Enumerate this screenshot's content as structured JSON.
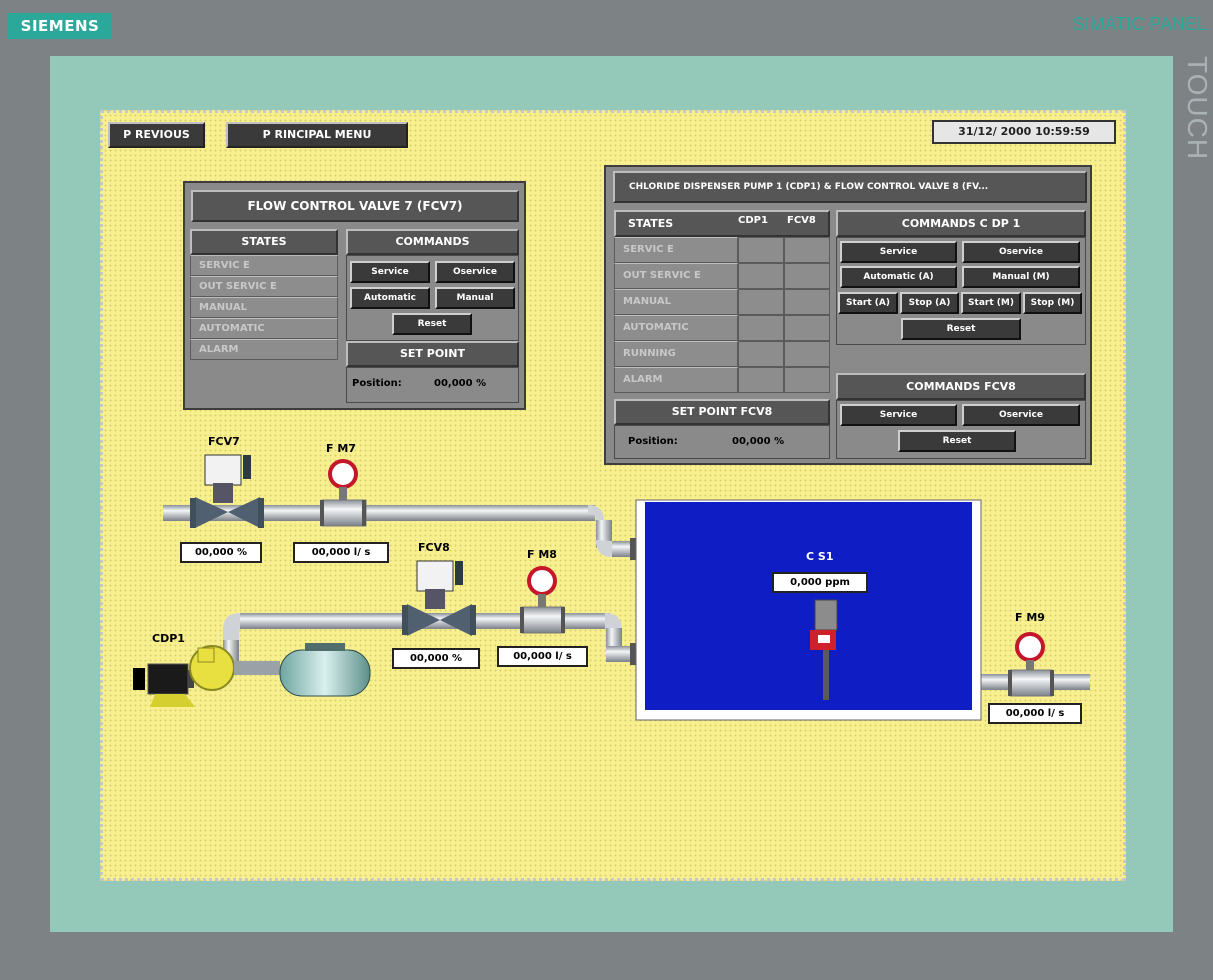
{
  "brand": "SIEMENS",
  "device": "SIMATIC PANEL",
  "touch": "TOUCH",
  "nav": {
    "previous": "P REVIOUS",
    "principal": "P RINCIPAL MENU"
  },
  "datetime": "31/12/ 2000 10:59:59",
  "fcv7_panel": {
    "title": "FLOW CONTROL VALVE 7 (FCV7)",
    "states_header": "STATES",
    "states": [
      "SERVIC E",
      "OUT SERVIC E",
      "MANUAL",
      "AUTOMATIC",
      "ALARM"
    ],
    "commands_header": "COMMANDS",
    "commands": {
      "service": "Service",
      "oservice": "Oservice",
      "automatic": "Automatic",
      "manual": "Manual",
      "reset": "Reset"
    },
    "setpoint_header": "SET POINT",
    "position_label": "Position:",
    "position_value": "00,000 %"
  },
  "cdp1_panel": {
    "title": "CHLORIDE DISPENSER PUMP 1 (CDP1) & FLOW CONTROL VALVE 8 (FV...",
    "states_header": "STATES",
    "col1": "CDP1",
    "col2": "FCV8",
    "states": [
      "SERVIC E",
      "OUT SERVIC E",
      "MANUAL",
      "AUTOMATIC",
      "RUNNING",
      "ALARM"
    ],
    "cmd_cdp1_header": "COMMANDS C DP 1",
    "cmd_cdp1": {
      "service": "Service",
      "oservice": "Oservice",
      "automatic": "Automatic (A)",
      "manual": "Manual (M)",
      "start_a": "Start (A)",
      "stop_a": "Stop (A)",
      "start_m": "Start (M)",
      "stop_m": "Stop (M)",
      "reset": "Reset"
    },
    "cmd_fcv8_header": "COMMANDS FCV8",
    "cmd_fcv8": {
      "service": "Service",
      "oservice": "Oservice",
      "reset": "Reset"
    },
    "setpoint_header": "SET POINT FCV8",
    "position_label": "Position:",
    "position_value": "00,000 %"
  },
  "process": {
    "fcv7_label": "FCV7",
    "fm7_label": "F M7",
    "fcv8_label": "FCV8",
    "fm8_label": "F M8",
    "fm9_label": "F M9",
    "cdp1_label": "CDP1",
    "cs1_label": "C S1",
    "fcv7_value": "00,000 %",
    "fm7_value": "00,000 l/ s",
    "fcv8_value": "00,000 %",
    "fm8_value": "00,000 l/ s",
    "fm9_value": "00,000 l/ s",
    "cs1_value": "0,000 ppm"
  },
  "colors": {
    "screen_bg": "#f8f08f",
    "tank": "#0e1ec4",
    "bezel": "#94c8b9",
    "brand": "#2ba89a"
  }
}
